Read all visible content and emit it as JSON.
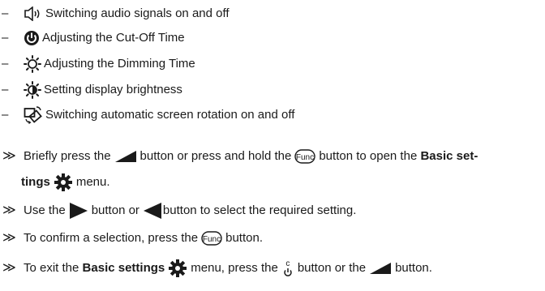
{
  "list_items": [
    {
      "icon": "speaker-icon",
      "text": "Switching audio signals on and off"
    },
    {
      "icon": "cut-off-time-icon",
      "text": "Adjusting the Cut-Off Time"
    },
    {
      "icon": "dimming-time-icon",
      "text": "Adjusting the Dimming Time"
    },
    {
      "icon": "brightness-icon",
      "text": "Setting display brightness"
    },
    {
      "icon": "screen-rotation-icon",
      "text": "Switching automatic screen rotation on and off"
    }
  ],
  "bullet_dash": "–",
  "step_marker": "≫",
  "steps": {
    "s1": {
      "a": "Briefly press the",
      "b": "button or press and hold the",
      "c": "button to open the",
      "bold1": "Basic set-",
      "bold2": "tings",
      "d": "menu."
    },
    "s2": {
      "a": "Use the",
      "b": "button or",
      "c": "button to select the required setting."
    },
    "s3": {
      "a": "To confirm a selection, press the",
      "b": "button."
    },
    "s4": {
      "a": "To exit the",
      "bold": "Basic settings",
      "b": "menu, press the",
      "c": "button or the",
      "d": "button."
    }
  },
  "func_label": "Func",
  "cancel_label": "c"
}
